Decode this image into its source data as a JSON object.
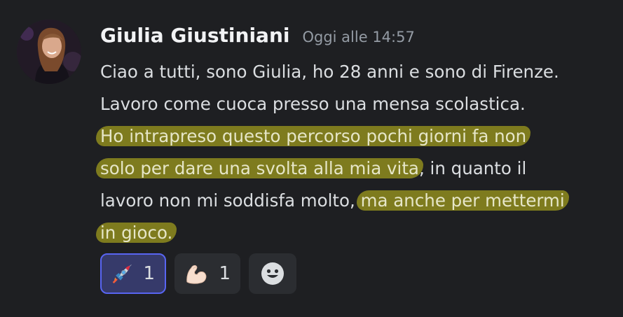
{
  "message": {
    "author": "Giulia Giustiniani",
    "timestamp": "Oggi alle 14:57",
    "lines": [
      {
        "plain": "Ciao a tutti, sono Giulia, ho 28 anni e sono di Firenze."
      },
      {
        "plain": "Lavoro come cuoca presso una mensa scolastica."
      },
      {
        "highlight": "Ho intrapreso questo percorso pochi giorni fa non"
      },
      {
        "highlight": "solo per dare una svolta alla mia vita",
        "plain": ", in quanto il"
      },
      {
        "plain": "lavoro non mi soddisfa molto, ",
        "highlight": "ma anche per mettermi"
      },
      {
        "highlight": "in gioco."
      }
    ],
    "highlight_color": "#9a961e"
  },
  "reactions": [
    {
      "emoji": "rocket-icon",
      "count": "1",
      "active": true
    },
    {
      "emoji": "flexed-biceps-icon",
      "count": "1",
      "active": false
    }
  ],
  "add_reaction": {
    "icon": "smiley-add-reaction-icon"
  },
  "colors": {
    "background": "#1e1f22",
    "username": "#f2f3f5",
    "timestamp": "#949ba4",
    "text": "#dbdee1",
    "reaction_active_border": "#5865f2"
  }
}
